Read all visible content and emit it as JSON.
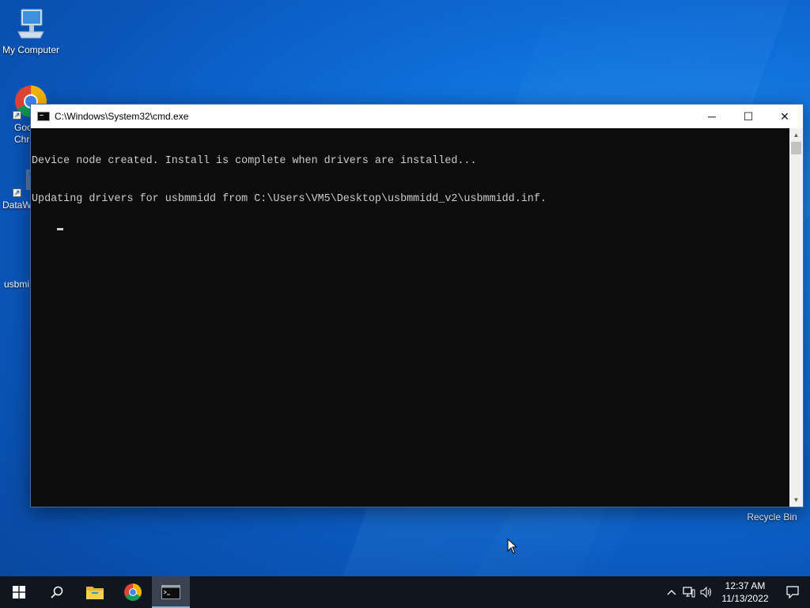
{
  "desktop": {
    "icons": [
      {
        "label": "My Computer"
      },
      {
        "label": "Goo\nChr"
      },
      {
        "label": "DataW"
      },
      {
        "label": "usbmi"
      },
      {
        "label": "Recycle Bin"
      }
    ]
  },
  "cmd_window": {
    "title": "C:\\Windows\\System32\\cmd.exe",
    "controls": {
      "minimize": "─",
      "maximize": "☐",
      "close": "✕"
    },
    "lines": [
      "Device node created. Install is complete when drivers are installed...",
      "Updating drivers for usbmmidd from C:\\Users\\VM5\\Desktop\\usbmmidd_v2\\usbmmidd.inf."
    ],
    "scroll_up": "▲",
    "scroll_down": "▼"
  },
  "taskbar": {
    "start_icon": "windows-logo-icon",
    "search_icon": "search-icon",
    "apps": [
      "file-explorer-icon",
      "chrome-icon",
      "cmd-icon"
    ],
    "tray": {
      "chevron": "^",
      "clock_time": "12:37 AM",
      "clock_date": "11/13/2022"
    }
  },
  "colors": {
    "console_bg": "#0c0c0c",
    "console_text": "#cccccc",
    "taskbar_bg": "#101620",
    "desktop_blue": "#0f6fdb"
  }
}
